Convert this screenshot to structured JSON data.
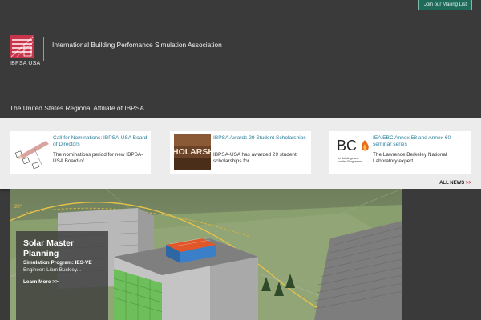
{
  "header": {
    "mailing_button": "Join our Mailing List",
    "logo_text": "IBPSA USA",
    "org_name": "International Building Perfomance Simulation Association",
    "tagline": "The United States Regional Affiliate of IBPSA"
  },
  "news": {
    "items": [
      {
        "title": "Call for Nominations: IBPSA-USA Board of Directors",
        "description": "The nominations period for new IBPSA-USA Board of...",
        "thumb_icon": "pencil-checkbox-icon"
      },
      {
        "title": "IBPSA Awards 29 Student Scholarships",
        "description": "IBPSA-USA has awarded 29 student scholarships for...",
        "thumb_text": "HOLARSH"
      },
      {
        "title": "IEA EBC Annex 58 and Annex 60 seminar series",
        "description": "The Lawrence Berkeley National Laboratory expert...",
        "thumb_text": "BC",
        "thumb_subtext": "in Buildings and\nunities Programme"
      }
    ],
    "all_news": "ALL NEWS",
    "all_news_arrow": ">>"
  },
  "hero": {
    "title": "Solar Master Planning",
    "program": "Simulation Program: IES-VE",
    "engineer": "Engineer: Liam Buckley...",
    "link": "Learn More >>",
    "angle_label": "20°"
  },
  "colors": {
    "background": "#3a3a3a",
    "brand_red": "#c8354a",
    "link_blue": "#2a7e9c",
    "mailing_green": "#1e6b5a"
  }
}
